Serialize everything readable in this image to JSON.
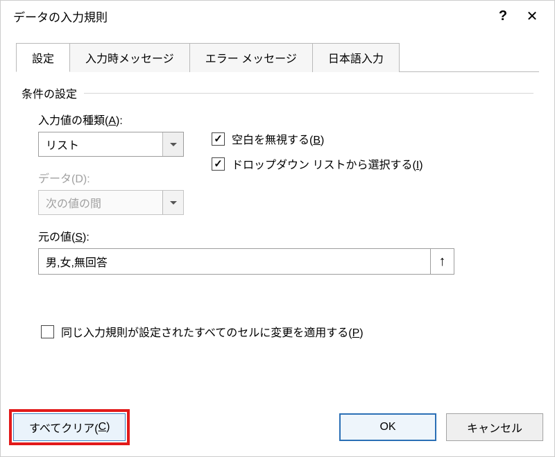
{
  "title": "データの入力規則",
  "help_symbol": "?",
  "close_symbol": "✕",
  "tabs": {
    "settings": "設定",
    "input_msg": "入力時メッセージ",
    "error_msg": "エラー メッセージ",
    "ime": "日本語入力"
  },
  "section": {
    "header": "条件の設定",
    "allow_label_pre": "入力値の種類(",
    "allow_key": "A",
    "allow_label_post": "):",
    "allow_value": "リスト",
    "data_label_pre": "データ(D):",
    "data_value": "次の値の間",
    "ignore_blank_pre": "空白を無視する(",
    "ignore_blank_key": "B",
    "ignore_blank_post": ")",
    "dropdown_pre": "ドロップダウン リストから選択する(",
    "dropdown_key": "I",
    "dropdown_post": ")",
    "source_label_pre": "元の値(",
    "source_key": "S",
    "source_label_post": "):",
    "source_value": "男,女,無回答",
    "apply_all_pre": "同じ入力規則が設定されたすべてのセルに変更を適用する(",
    "apply_all_key": "P",
    "apply_all_post": ")"
  },
  "buttons": {
    "clear_pre": "すべてクリア(",
    "clear_key": "C",
    "clear_post": ")",
    "ok": "OK",
    "cancel": "キャンセル"
  }
}
